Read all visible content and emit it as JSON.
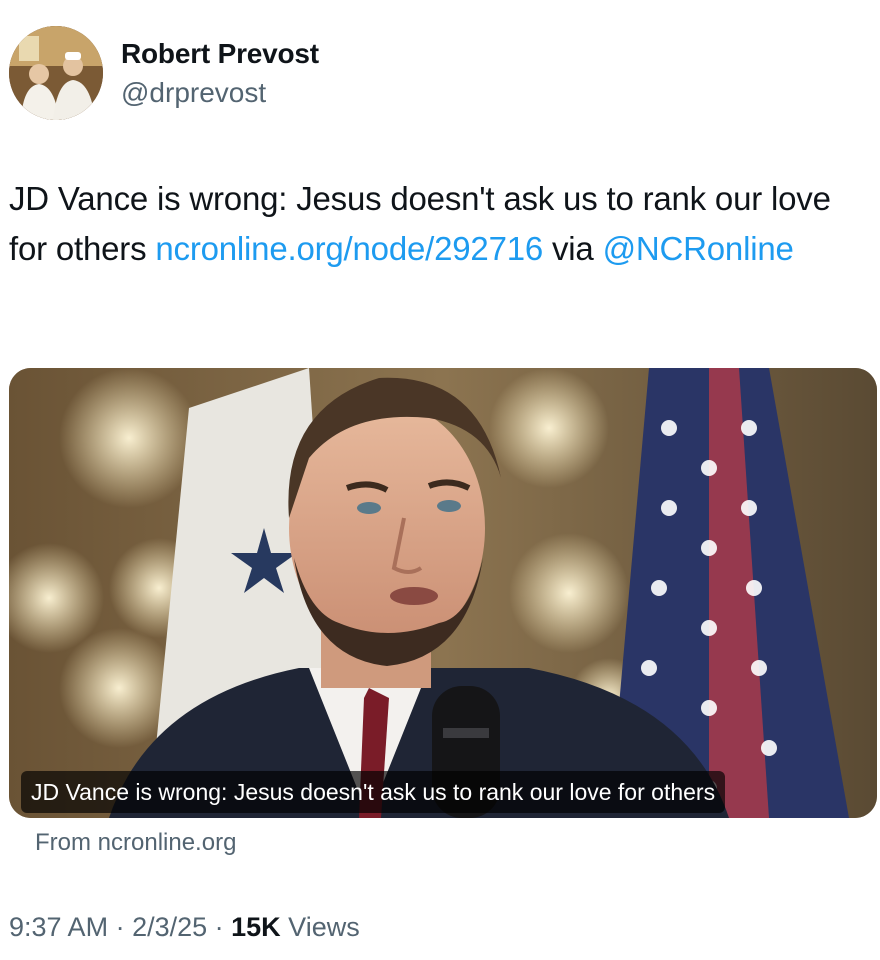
{
  "author": {
    "name": "Robert Prevost",
    "handle": "@drprevost"
  },
  "tweet": {
    "text_part1": "JD Vance is wrong: Jesus doesn't ask us to rank our love for others ",
    "link_text": "ncronline.org/node/292716",
    "text_part2": " via ",
    "mention": "@NCRonline"
  },
  "card": {
    "caption": "JD Vance is wrong: Jesus doesn't ask us to rank our love for others",
    "source": "From ncronline.org"
  },
  "meta": {
    "time": "9:37 AM",
    "separator": " · ",
    "date": "2/3/25",
    "views_count": "15K",
    "views_label": " Views"
  },
  "colors": {
    "link": "#1d9bf0",
    "secondary_text": "#536471",
    "primary_text": "#0f1419"
  }
}
